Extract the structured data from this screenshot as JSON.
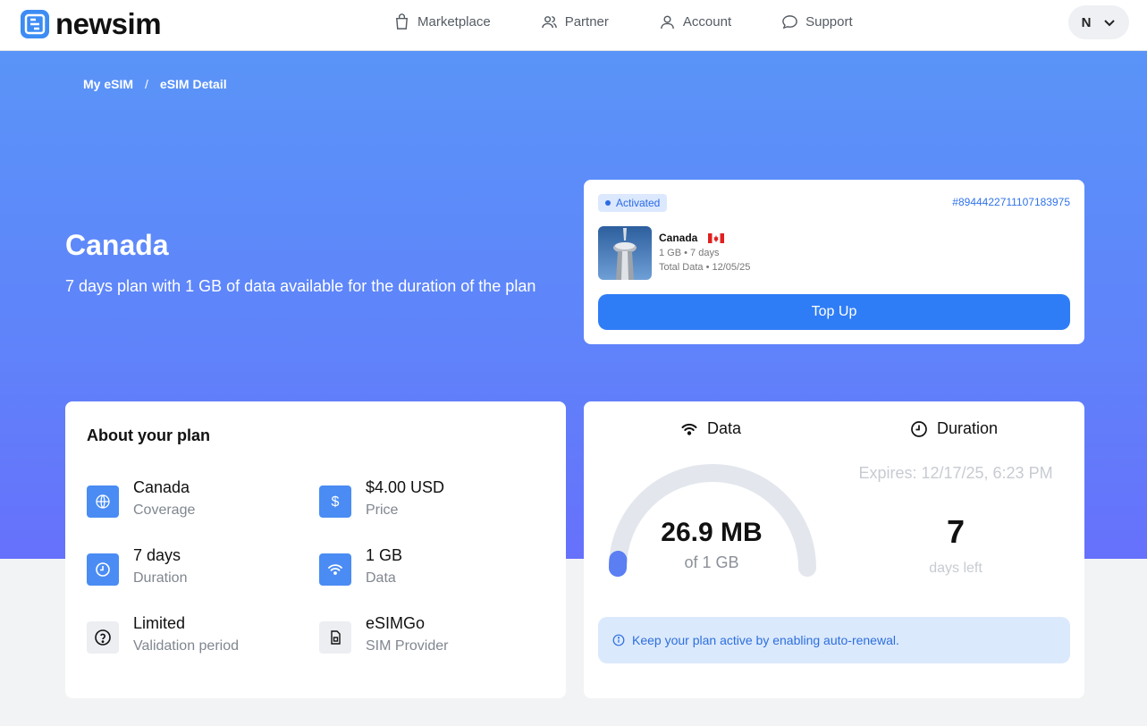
{
  "brand": {
    "name": "newsim"
  },
  "nav": [
    {
      "label": "Marketplace",
      "icon": "shopping-bag-icon"
    },
    {
      "label": "Partner",
      "icon": "users-icon"
    },
    {
      "label": "Account",
      "icon": "user-icon"
    },
    {
      "label": "Support",
      "icon": "chat-icon"
    }
  ],
  "user": {
    "initial": "N"
  },
  "breadcrumb": {
    "root": "My eSIM",
    "sep": "/",
    "current": "eSIM Detail"
  },
  "hero": {
    "title": "Canada",
    "subtitle": "7 days plan with 1 GB of data available for the duration of the plan"
  },
  "summary": {
    "status": "Activated",
    "iccid": "#8944422711107183975",
    "plan_name": "Canada",
    "plan_meta": "1 GB • 7 days",
    "plan_total": "Total Data • 12/05/25",
    "topup_label": "Top Up"
  },
  "about": {
    "title": "About your plan",
    "items": [
      {
        "value": "Canada",
        "label": "Coverage",
        "icon": "globe-icon"
      },
      {
        "value": "$4.00 USD",
        "label": "Price",
        "icon": "dollar-icon"
      },
      {
        "value": "7 days",
        "label": "Duration",
        "icon": "clock-icon"
      },
      {
        "value": "1 GB",
        "label": "Data",
        "icon": "wifi-icon"
      },
      {
        "value": "Limited",
        "label": "Validation period",
        "icon": "question-icon"
      },
      {
        "value": "eSIMGo",
        "label": "SIM Provider",
        "icon": "sim-card-icon"
      }
    ]
  },
  "usage": {
    "data_title": "Data",
    "duration_title": "Duration",
    "used": "26.9 MB",
    "of": "of 1 GB",
    "used_fraction": 0.027,
    "expires": "Expires: 12/17/25, 6:23 PM",
    "days_left": "7",
    "days_left_label": "days left",
    "info": "Keep your plan active by enabling auto-renewal."
  }
}
